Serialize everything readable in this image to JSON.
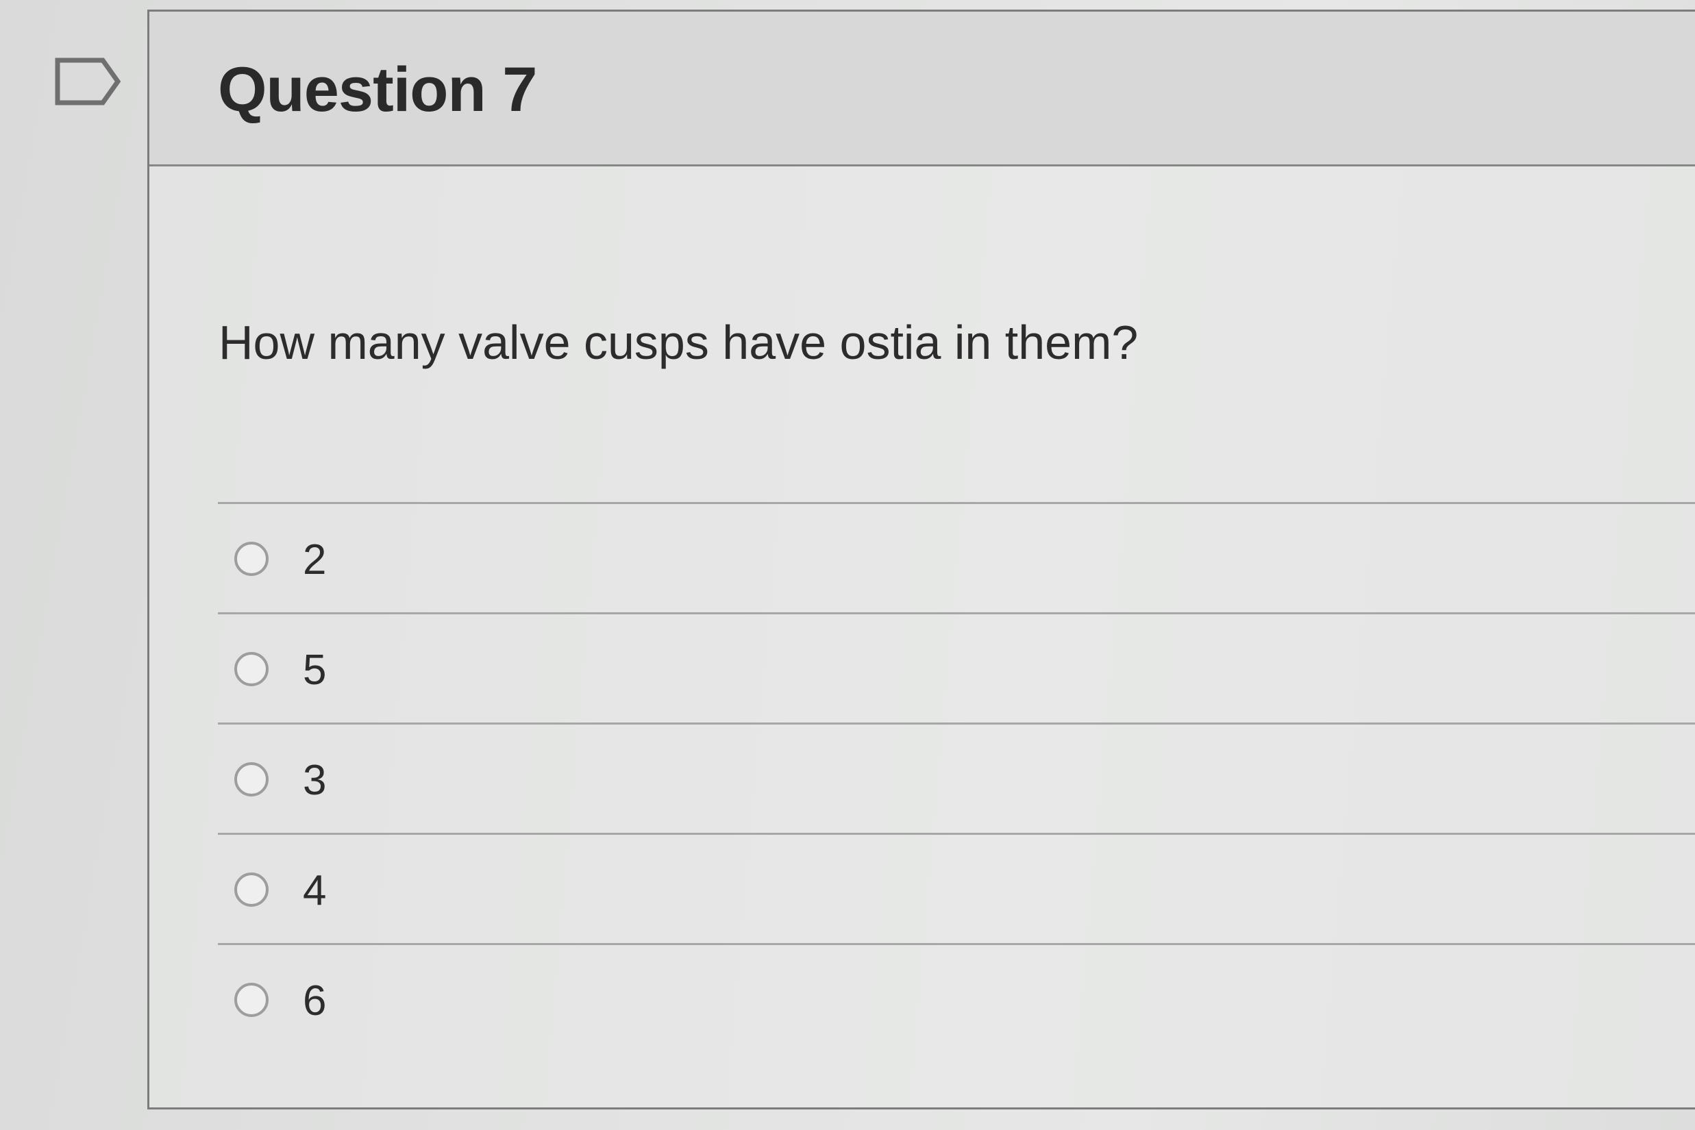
{
  "question": {
    "title": "Question 7",
    "text": "How many valve cusps have ostia in them?",
    "flag_icon": "flag-outline-icon",
    "answers": [
      {
        "label": "2",
        "selected": false
      },
      {
        "label": "5",
        "selected": false
      },
      {
        "label": "3",
        "selected": false
      },
      {
        "label": "4",
        "selected": false
      },
      {
        "label": "6",
        "selected": false
      }
    ]
  },
  "colors": {
    "text": "#2c2c2c",
    "border": "#7b7c7b",
    "header_bg": "#d7d8d7"
  }
}
